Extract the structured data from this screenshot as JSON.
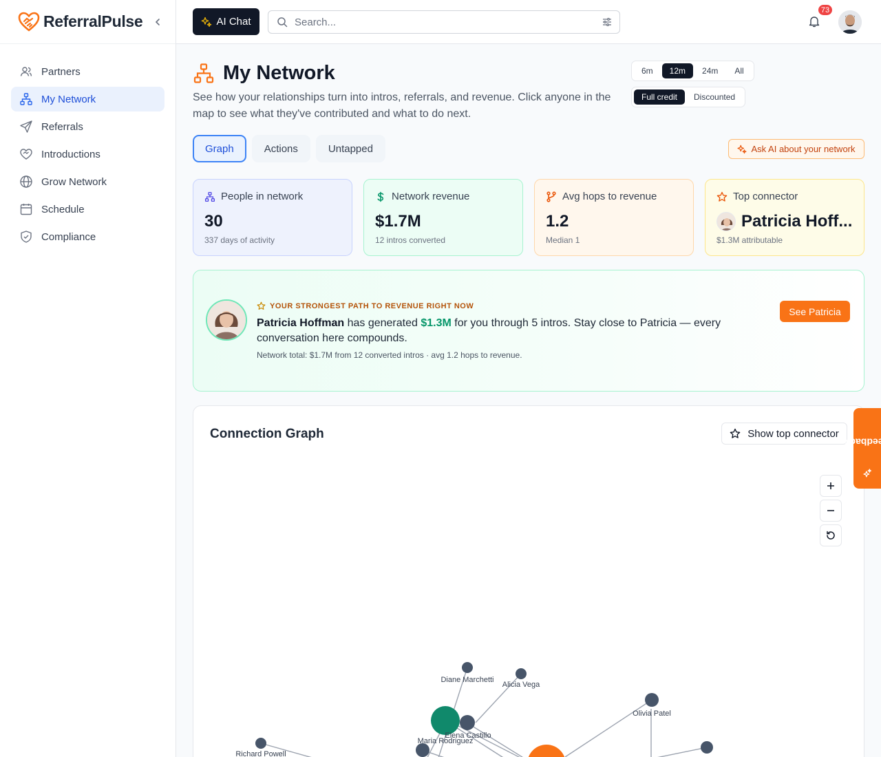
{
  "brand": {
    "name": "ReferralPulse",
    "accent": "#f97316"
  },
  "sidebar": {
    "items": [
      {
        "label": "Partners",
        "icon": "users-icon"
      },
      {
        "label": "My Network",
        "icon": "network-icon",
        "active": true
      },
      {
        "label": "Referrals",
        "icon": "send-icon"
      },
      {
        "label": "Introductions",
        "icon": "handshake-icon"
      },
      {
        "label": "Grow Network",
        "icon": "globe-icon"
      },
      {
        "label": "Schedule",
        "icon": "calendar-icon"
      },
      {
        "label": "Compliance",
        "icon": "shield-icon"
      }
    ]
  },
  "topbar": {
    "ai_chat_label": "AI Chat",
    "search_placeholder": "Search...",
    "notification_count": "73"
  },
  "page": {
    "title": "My Network",
    "subtitle": "See how your relationships turn into intros, referrals, and revenue. Click anyone in the map to see what they've contributed and what to do next.",
    "range_options": [
      "6m",
      "12m",
      "24m",
      "All"
    ],
    "range_selected": "12m",
    "credit_options": [
      "Full credit",
      "Discounted"
    ],
    "credit_selected": "Full credit"
  },
  "tabs": [
    {
      "label": "Graph",
      "active": true
    },
    {
      "label": "Actions"
    },
    {
      "label": "Untapped"
    }
  ],
  "ask_ai_label": "Ask AI about your network",
  "stats": [
    {
      "label": "People in network",
      "value": "30",
      "sub": "337 days of activity",
      "icon": "network-icon"
    },
    {
      "label": "Network revenue",
      "value": "$1.7M",
      "sub": "12 intros converted",
      "icon": "dollar-icon"
    },
    {
      "label": "Avg hops to revenue",
      "value": "1.2",
      "sub": "Median 1",
      "icon": "branch-icon"
    },
    {
      "label": "Top connector",
      "value": "Patricia Hoff...",
      "sub": "$1.3M attributable",
      "icon": "star-icon"
    }
  ],
  "insight": {
    "eyebrow": "YOUR STRONGEST PATH TO REVENUE RIGHT NOW",
    "name": "Patricia Hoffman",
    "text_1": " has generated ",
    "amount": "$1.3M",
    "text_2": " for you through 5 intros. Stay close to Patricia — every conversation here compounds.",
    "footer": "Network total: $1.7M from 12 converted intros · avg 1.2 hops to revenue.",
    "button": "See Patricia"
  },
  "graph": {
    "title": "Connection Graph",
    "show_top_connector": "Show top connector",
    "nodes": [
      {
        "label": "Diane Marchetti"
      },
      {
        "label": "Alicia Vega"
      },
      {
        "label": "Olivia Patel"
      },
      {
        "label": "Elena Castillo"
      },
      {
        "label": "Maria Rodriguez"
      },
      {
        "label": "Richard Powell"
      }
    ]
  },
  "feedback_label": "Feedback"
}
